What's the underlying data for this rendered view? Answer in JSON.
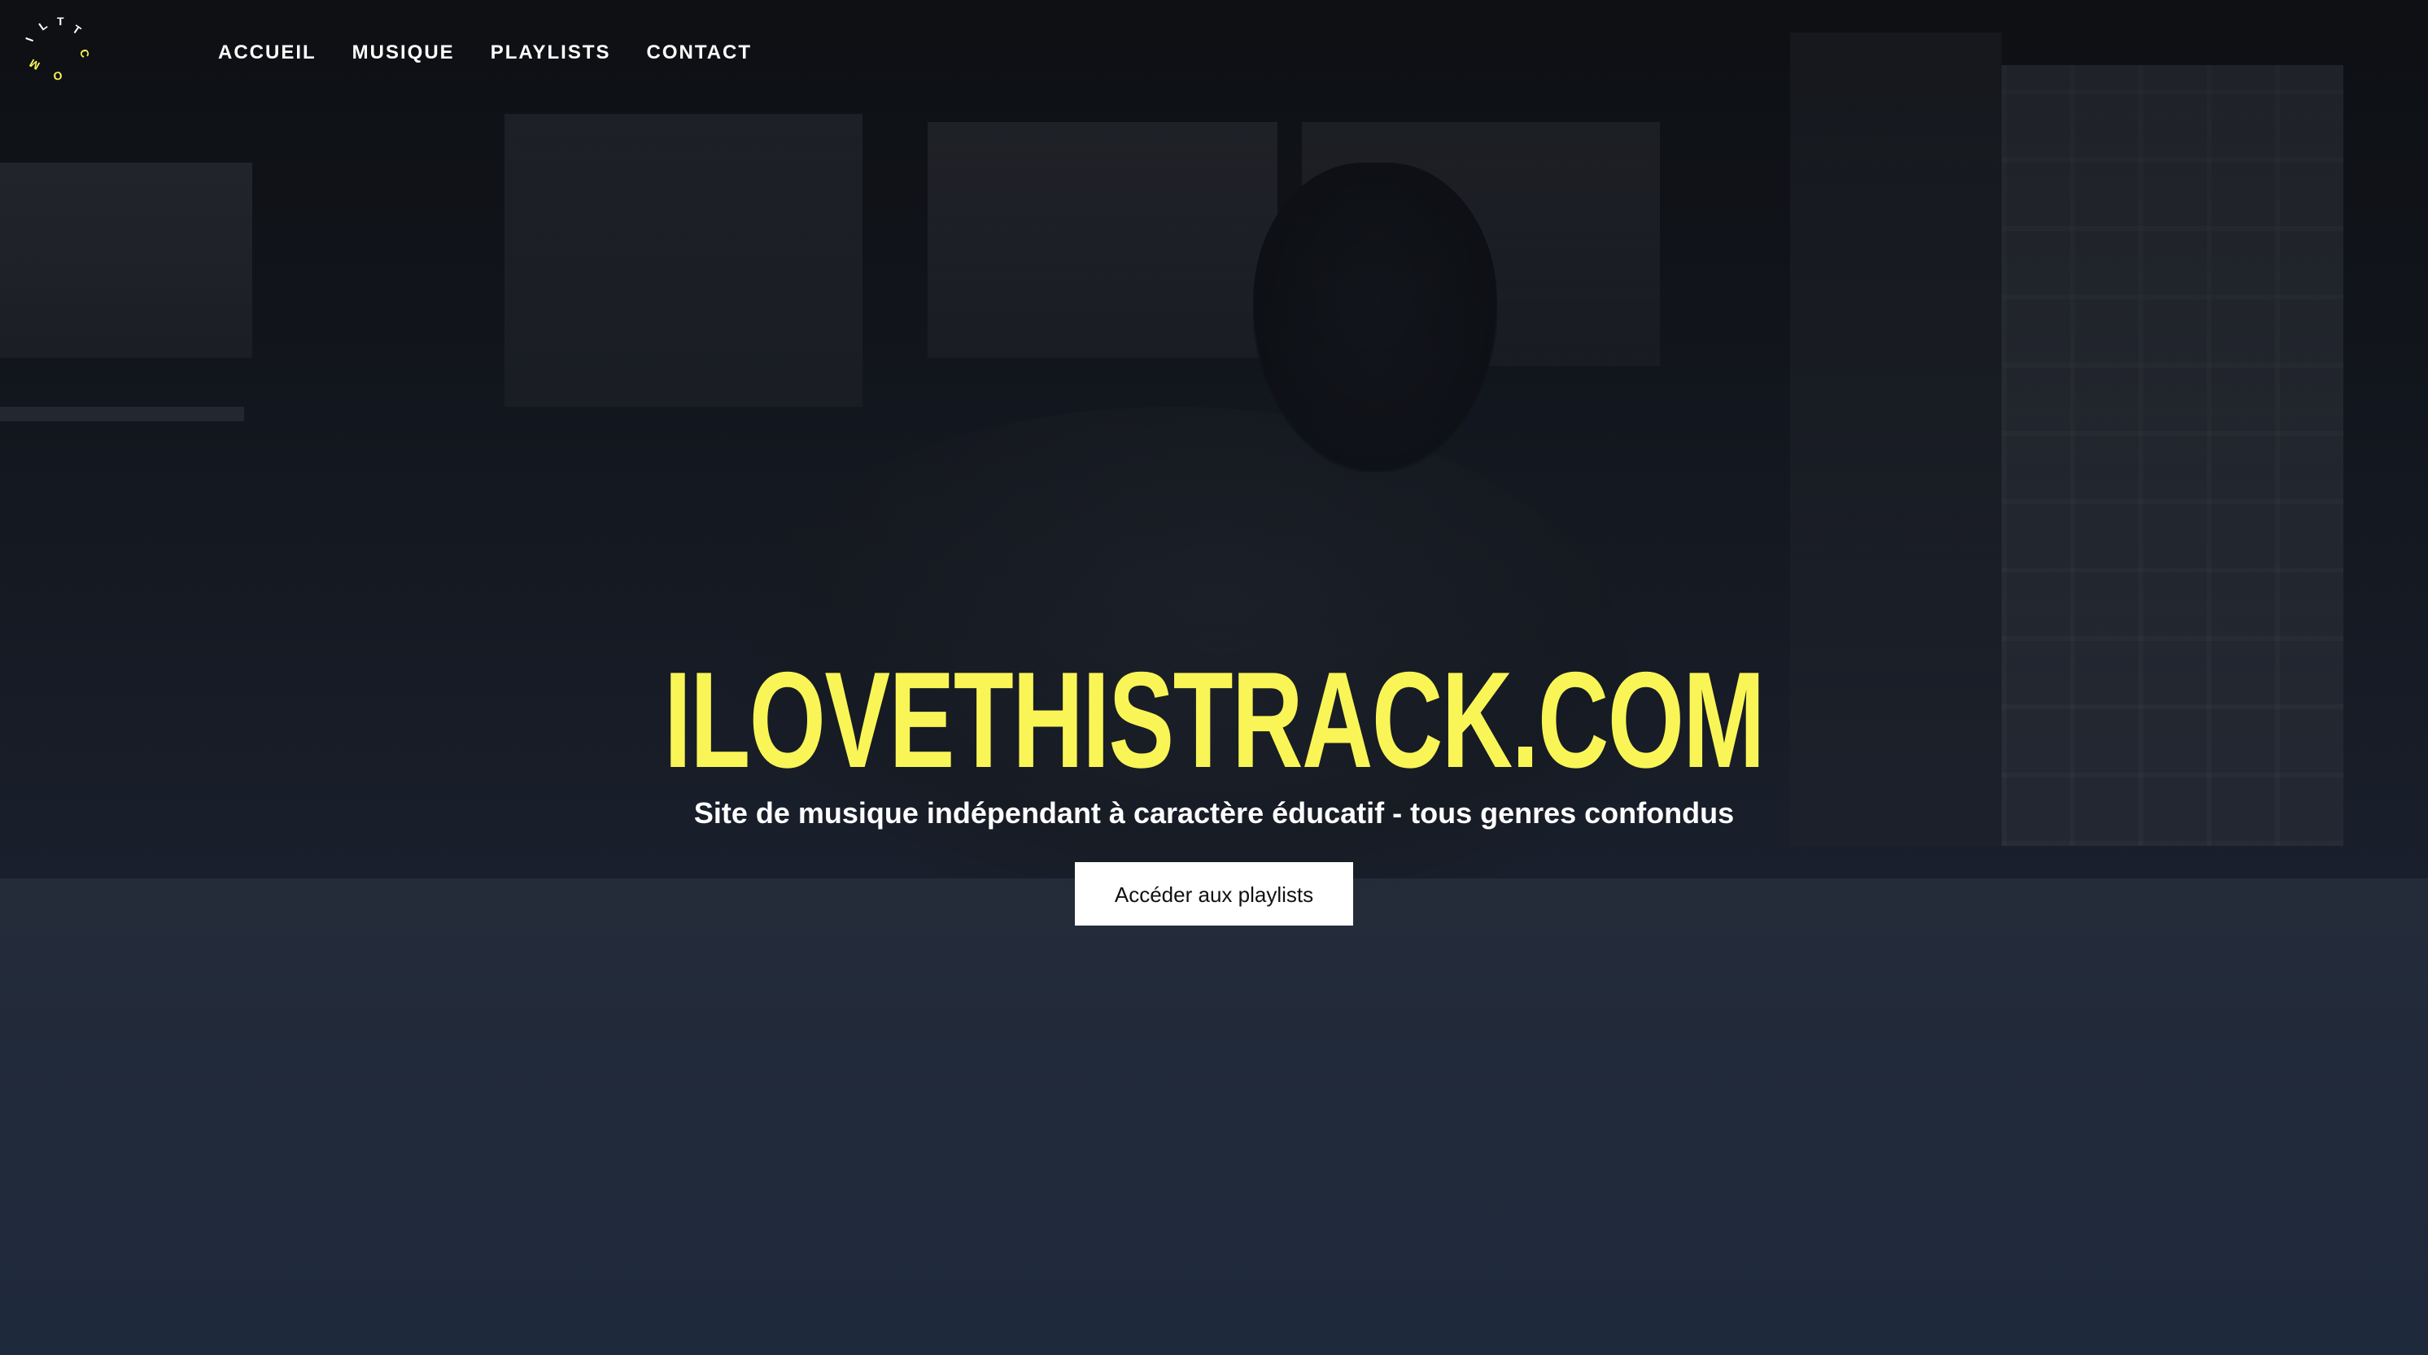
{
  "brand": {
    "logo_letters": [
      "I",
      "L",
      "T",
      "T",
      "C",
      "O",
      "M"
    ],
    "logo_color": "#f9f556",
    "logo_text_color": "#ffffff"
  },
  "nav": {
    "items": [
      {
        "label": "ACCUEIL"
      },
      {
        "label": "MUSIQUE"
      },
      {
        "label": "PLAYLISTS"
      },
      {
        "label": "CONTACT"
      }
    ]
  },
  "hero": {
    "title": "ILOVETHISTRACK.COM",
    "subtitle": "Site de musique indépendant à caractère éducatif - tous genres confondus",
    "cta_label": "Accéder aux playlists"
  },
  "colors": {
    "accent": "#f9f556",
    "text": "#ffffff",
    "button_bg": "#ffffff",
    "button_text": "#111111",
    "background": "#1b2130"
  }
}
